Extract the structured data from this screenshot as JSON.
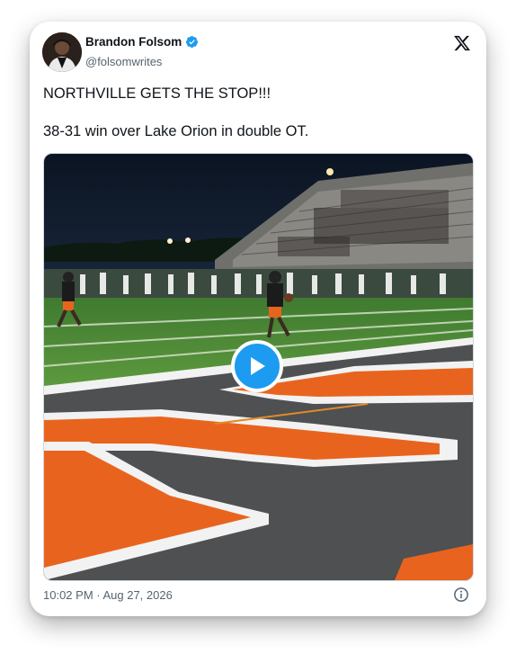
{
  "author": {
    "display_name": "Brandon Folsom",
    "handle": "@folsomwrites",
    "verified": true
  },
  "icons": {
    "verified": "verified-badge-icon",
    "platform": "x-logo-icon",
    "play": "play-icon",
    "info": "info-icon"
  },
  "tweet": {
    "line1": "NORTHVILLE GETS THE STOP!!!",
    "line2": "38-31 win over Lake Orion in double OT.",
    "timestamp": "10:02 PM · Aug 27, 2026"
  },
  "colors": {
    "accent": "#1d9bf0",
    "text": "#0f1419",
    "muted": "#536471",
    "field_orange": "#e8641e"
  }
}
